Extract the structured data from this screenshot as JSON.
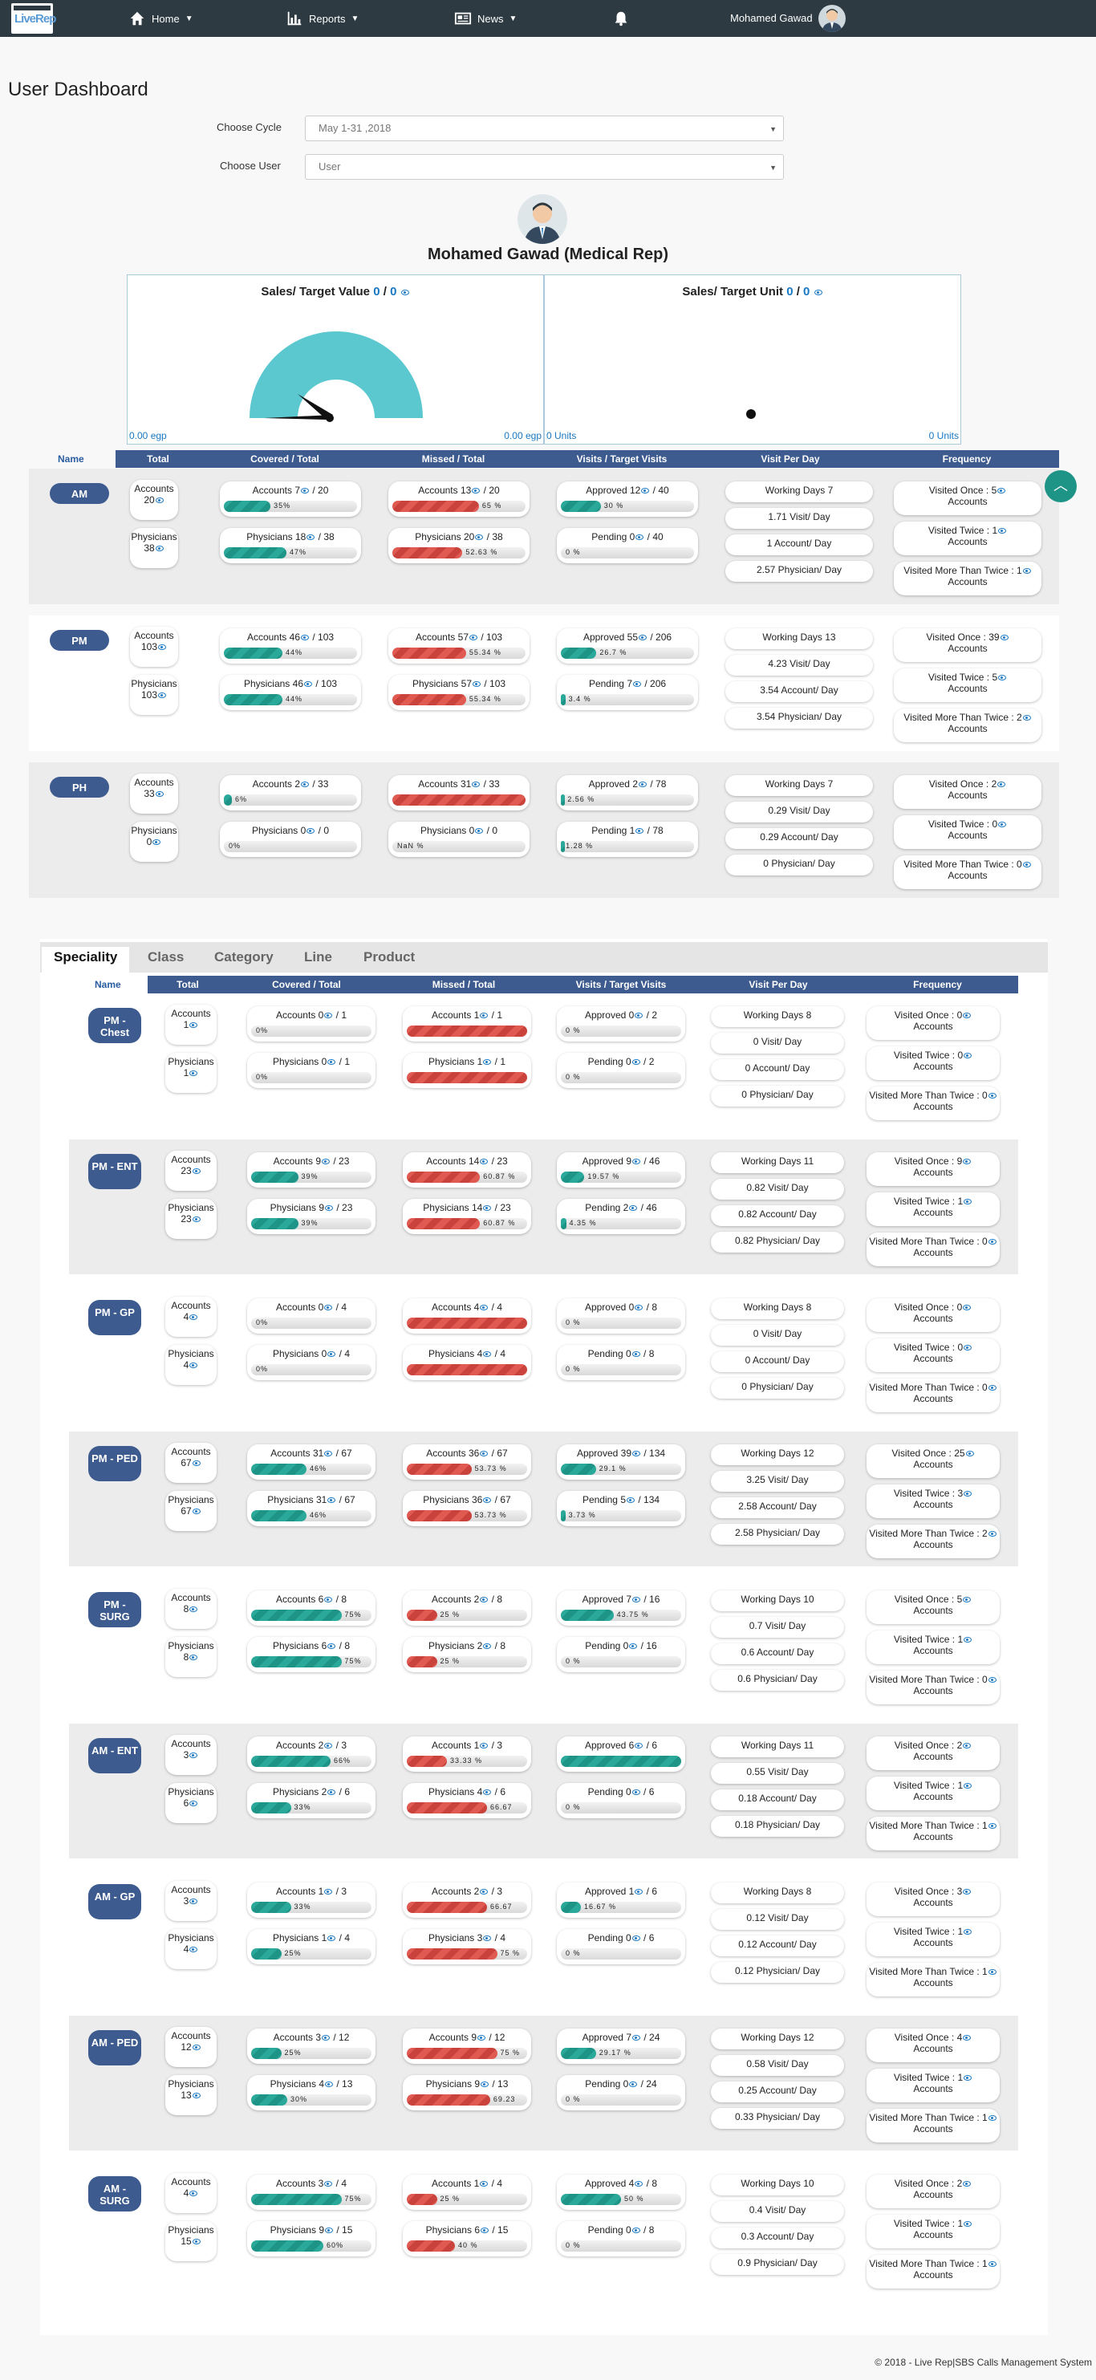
{
  "nav": {
    "logo_text": "LiveRep",
    "home": "Home",
    "reports": "Reports",
    "news": "News",
    "user": "Mohamed Gawad"
  },
  "page_title": "User Dashboard",
  "filters": {
    "cycle_label": "Choose Cycle",
    "cycle_value": "May 1-31 ,2018",
    "user_label": "Choose User",
    "user_value": "User"
  },
  "rep_name": "Mohamed Gawad (Medical Rep)",
  "gauges": {
    "value": {
      "title": "Sales/ Target Value",
      "sales": "0",
      "target": "0",
      "left": "0.00 egp",
      "right": "0.00 egp"
    },
    "unit": {
      "title": "Sales/ Target Unit",
      "sales": "0",
      "target": "0",
      "left": "0 Units",
      "right": "0 Units"
    }
  },
  "headers": {
    "name": "Name",
    "total": "Total",
    "covered": "Covered / Total",
    "missed": "Missed / Total",
    "visits": "Visits / Target Visits",
    "per_day": "Visit Per Day",
    "frequency": "Frequency"
  },
  "labels": {
    "accounts": "Accounts",
    "physicians": "Physicians",
    "approved": "Approved",
    "pending": "Pending",
    "working_days": "Working Days",
    "visit_day": "Visit/ Day",
    "account_day": "Account/ Day",
    "physician_day": "Physician/ Day",
    "visited_once": "Visited Once :",
    "visited_twice": "Visited Twice :",
    "visited_more": "Visited More Than Twice :",
    "accounts_word": "Accounts"
  },
  "shifts": [
    {
      "name": "AM",
      "acc": 20,
      "phy": 38,
      "cov_acc": {
        "n": 7,
        "t": 20,
        "pct": "35%",
        "p": 35
      },
      "cov_phy": {
        "n": 18,
        "t": 38,
        "pct": "47%",
        "p": 47
      },
      "mis_acc": {
        "n": 13,
        "t": 20,
        "pct": "65 %",
        "p": 65
      },
      "mis_phy": {
        "n": 20,
        "t": 38,
        "pct": "52.63 %",
        "p": 52.63
      },
      "approved": {
        "n": 12,
        "t": 40,
        "pct": "30 %",
        "p": 30
      },
      "pending": {
        "n": 0,
        "t": 40,
        "pct": "0 %",
        "p": 0
      },
      "wd": 7,
      "vpd": "1.71",
      "apd": "1",
      "ppd": "2.57",
      "once": 5,
      "twice": 1,
      "more": 1
    },
    {
      "name": "PM",
      "acc": 103,
      "phy": 103,
      "cov_acc": {
        "n": 46,
        "t": 103,
        "pct": "44%",
        "p": 44
      },
      "cov_phy": {
        "n": 46,
        "t": 103,
        "pct": "44%",
        "p": 44
      },
      "mis_acc": {
        "n": 57,
        "t": 103,
        "pct": "55.34 %",
        "p": 55.34
      },
      "mis_phy": {
        "n": 57,
        "t": 103,
        "pct": "55.34 %",
        "p": 55.34
      },
      "approved": {
        "n": 55,
        "t": 206,
        "pct": "26.7 %",
        "p": 26.7
      },
      "pending": {
        "n": 7,
        "t": 206,
        "pct": "3.4 %",
        "p": 3.4
      },
      "wd": 13,
      "vpd": "4.23",
      "apd": "3.54",
      "ppd": "3.54",
      "once": 39,
      "twice": 5,
      "more": 2
    },
    {
      "name": "PH",
      "acc": 33,
      "phy": 0,
      "cov_acc": {
        "n": 2,
        "t": 33,
        "pct": "6%",
        "p": 6
      },
      "cov_phy": {
        "n": 0,
        "t": 0,
        "pct": "0%",
        "p": 0
      },
      "mis_acc": {
        "n": 31,
        "t": 33,
        "pct": "",
        "p": 100
      },
      "mis_phy": {
        "n": 0,
        "t": 0,
        "pct": "NaN %",
        "p": 0
      },
      "approved": {
        "n": 2,
        "t": 78,
        "pct": "2.56 %",
        "p": 2.56
      },
      "pending": {
        "n": 1,
        "t": 78,
        "pct": "1.28 %",
        "p": 1.28
      },
      "wd": 7,
      "vpd": "0.29",
      "apd": "0.29",
      "ppd": "0",
      "once": 2,
      "twice": 0,
      "more": 0
    }
  ],
  "tabs": [
    "Speciality",
    "Class",
    "Category",
    "Line",
    "Product"
  ],
  "specialities": [
    {
      "name": "PM - Chest",
      "acc": 1,
      "phy": 1,
      "cov_acc": {
        "n": 0,
        "t": 1,
        "pct": "0%",
        "p": 0
      },
      "cov_phy": {
        "n": 0,
        "t": 1,
        "pct": "0%",
        "p": 0
      },
      "mis_acc": {
        "n": 1,
        "t": 1,
        "pct": "",
        "p": 100
      },
      "mis_phy": {
        "n": 1,
        "t": 1,
        "pct": "",
        "p": 100
      },
      "approved": {
        "n": 0,
        "t": 2,
        "pct": "0 %",
        "p": 0
      },
      "pending": {
        "n": 0,
        "t": 2,
        "pct": "0 %",
        "p": 0
      },
      "wd": 8,
      "vpd": "0",
      "apd": "0",
      "ppd": "0",
      "once": 0,
      "twice": 0,
      "more": 0
    },
    {
      "name": "PM - ENT",
      "acc": 23,
      "phy": 23,
      "cov_acc": {
        "n": 9,
        "t": 23,
        "pct": "39%",
        "p": 39
      },
      "cov_phy": {
        "n": 9,
        "t": 23,
        "pct": "39%",
        "p": 39
      },
      "mis_acc": {
        "n": 14,
        "t": 23,
        "pct": "60.87 %",
        "p": 60.87
      },
      "mis_phy": {
        "n": 14,
        "t": 23,
        "pct": "60.87 %",
        "p": 60.87
      },
      "approved": {
        "n": 9,
        "t": 46,
        "pct": "19.57 %",
        "p": 19.57
      },
      "pending": {
        "n": 2,
        "t": 46,
        "pct": "4.35 %",
        "p": 4.35
      },
      "wd": 11,
      "vpd": "0.82",
      "apd": "0.82",
      "ppd": "0.82",
      "once": 9,
      "twice": 1,
      "more": 0
    },
    {
      "name": "PM - GP",
      "acc": 4,
      "phy": 4,
      "cov_acc": {
        "n": 0,
        "t": 4,
        "pct": "0%",
        "p": 0
      },
      "cov_phy": {
        "n": 0,
        "t": 4,
        "pct": "0%",
        "p": 0
      },
      "mis_acc": {
        "n": 4,
        "t": 4,
        "pct": "",
        "p": 100
      },
      "mis_phy": {
        "n": 4,
        "t": 4,
        "pct": "",
        "p": 100
      },
      "approved": {
        "n": 0,
        "t": 8,
        "pct": "0 %",
        "p": 0
      },
      "pending": {
        "n": 0,
        "t": 8,
        "pct": "0 %",
        "p": 0
      },
      "wd": 8,
      "vpd": "0",
      "apd": "0",
      "ppd": "0",
      "once": 0,
      "twice": 0,
      "more": 0
    },
    {
      "name": "PM - PED",
      "acc": 67,
      "phy": 67,
      "cov_acc": {
        "n": 31,
        "t": 67,
        "pct": "46%",
        "p": 46
      },
      "cov_phy": {
        "n": 31,
        "t": 67,
        "pct": "46%",
        "p": 46
      },
      "mis_acc": {
        "n": 36,
        "t": 67,
        "pct": "53.73 %",
        "p": 53.73
      },
      "mis_phy": {
        "n": 36,
        "t": 67,
        "pct": "53.73 %",
        "p": 53.73
      },
      "approved": {
        "n": 39,
        "t": 134,
        "pct": "29.1 %",
        "p": 29.1
      },
      "pending": {
        "n": 5,
        "t": 134,
        "pct": "3.73 %",
        "p": 3.73
      },
      "wd": 12,
      "vpd": "3.25",
      "apd": "2.58",
      "ppd": "2.58",
      "once": 25,
      "twice": 3,
      "more": 2
    },
    {
      "name": "PM - SURG",
      "acc": 8,
      "phy": 8,
      "cov_acc": {
        "n": 6,
        "t": 8,
        "pct": "75%",
        "p": 75
      },
      "cov_phy": {
        "n": 6,
        "t": 8,
        "pct": "75%",
        "p": 75
      },
      "mis_acc": {
        "n": 2,
        "t": 8,
        "pct": "25 %",
        "p": 25
      },
      "mis_phy": {
        "n": 2,
        "t": 8,
        "pct": "25 %",
        "p": 25
      },
      "approved": {
        "n": 7,
        "t": 16,
        "pct": "43.75 %",
        "p": 43.75
      },
      "pending": {
        "n": 0,
        "t": 16,
        "pct": "0 %",
        "p": 0
      },
      "wd": 10,
      "vpd": "0.7",
      "apd": "0.6",
      "ppd": "0.6",
      "once": 5,
      "twice": 1,
      "more": 0
    },
    {
      "name": "AM - ENT",
      "acc": 3,
      "phy": 6,
      "cov_acc": {
        "n": 2,
        "t": 3,
        "pct": "66%",
        "p": 66
      },
      "cov_phy": {
        "n": 2,
        "t": 6,
        "pct": "33%",
        "p": 33
      },
      "mis_acc": {
        "n": 1,
        "t": 3,
        "pct": "33.33 %",
        "p": 33.33
      },
      "mis_phy": {
        "n": 4,
        "t": 6,
        "pct": "66.67",
        "p": 66.67
      },
      "approved": {
        "n": 6,
        "t": 6,
        "pct": "",
        "p": 100
      },
      "pending": {
        "n": 0,
        "t": 6,
        "pct": "0 %",
        "p": 0
      },
      "wd": 11,
      "vpd": "0.55",
      "apd": "0.18",
      "ppd": "0.18",
      "once": 2,
      "twice": 1,
      "more": 1
    },
    {
      "name": "AM - GP",
      "acc": 3,
      "phy": 4,
      "cov_acc": {
        "n": 1,
        "t": 3,
        "pct": "33%",
        "p": 33
      },
      "cov_phy": {
        "n": 1,
        "t": 4,
        "pct": "25%",
        "p": 25
      },
      "mis_acc": {
        "n": 2,
        "t": 3,
        "pct": "66.67",
        "p": 66.67
      },
      "mis_phy": {
        "n": 3,
        "t": 4,
        "pct": "75 %",
        "p": 75
      },
      "approved": {
        "n": 1,
        "t": 6,
        "pct": "16.67 %",
        "p": 16.67
      },
      "pending": {
        "n": 0,
        "t": 6,
        "pct": "0 %",
        "p": 0
      },
      "wd": 8,
      "vpd": "0.12",
      "apd": "0.12",
      "ppd": "0.12",
      "once": 3,
      "twice": 1,
      "more": 1
    },
    {
      "name": "AM - PED",
      "acc": 12,
      "phy": 13,
      "cov_acc": {
        "n": 3,
        "t": 12,
        "pct": "25%",
        "p": 25
      },
      "cov_phy": {
        "n": 4,
        "t": 13,
        "pct": "30%",
        "p": 30
      },
      "mis_acc": {
        "n": 9,
        "t": 12,
        "pct": "75 %",
        "p": 75
      },
      "mis_phy": {
        "n": 9,
        "t": 13,
        "pct": "69.23",
        "p": 69.23
      },
      "approved": {
        "n": 7,
        "t": 24,
        "pct": "29.17 %",
        "p": 29.17
      },
      "pending": {
        "n": 0,
        "t": 24,
        "pct": "0 %",
        "p": 0
      },
      "wd": 12,
      "vpd": "0.58",
      "apd": "0.25",
      "ppd": "0.33",
      "once": 4,
      "twice": 1,
      "more": 1
    },
    {
      "name": "AM - SURG",
      "acc": 4,
      "phy": 15,
      "cov_acc": {
        "n": 3,
        "t": 4,
        "pct": "75%",
        "p": 75
      },
      "cov_phy": {
        "n": 9,
        "t": 15,
        "pct": "60%",
        "p": 60
      },
      "mis_acc": {
        "n": 1,
        "t": 4,
        "pct": "25 %",
        "p": 25
      },
      "mis_phy": {
        "n": 6,
        "t": 15,
        "pct": "40 %",
        "p": 40
      },
      "approved": {
        "n": 4,
        "t": 8,
        "pct": "50 %",
        "p": 50
      },
      "pending": {
        "n": 0,
        "t": 8,
        "pct": "0 %",
        "p": 0
      },
      "wd": 10,
      "vpd": "0.4",
      "apd": "0.3",
      "ppd": "0.9",
      "once": 2,
      "twice": 1,
      "more": 1
    }
  ],
  "footer": "© 2018 - Live Rep|SBS Calls Management System",
  "colors": {
    "navbar": "#2d3a42",
    "header": "#3d5b8e",
    "teal": "#1e9487",
    "red": "#c9433c",
    "gauge": "#5bc8d0",
    "link": "#1a78c2"
  }
}
